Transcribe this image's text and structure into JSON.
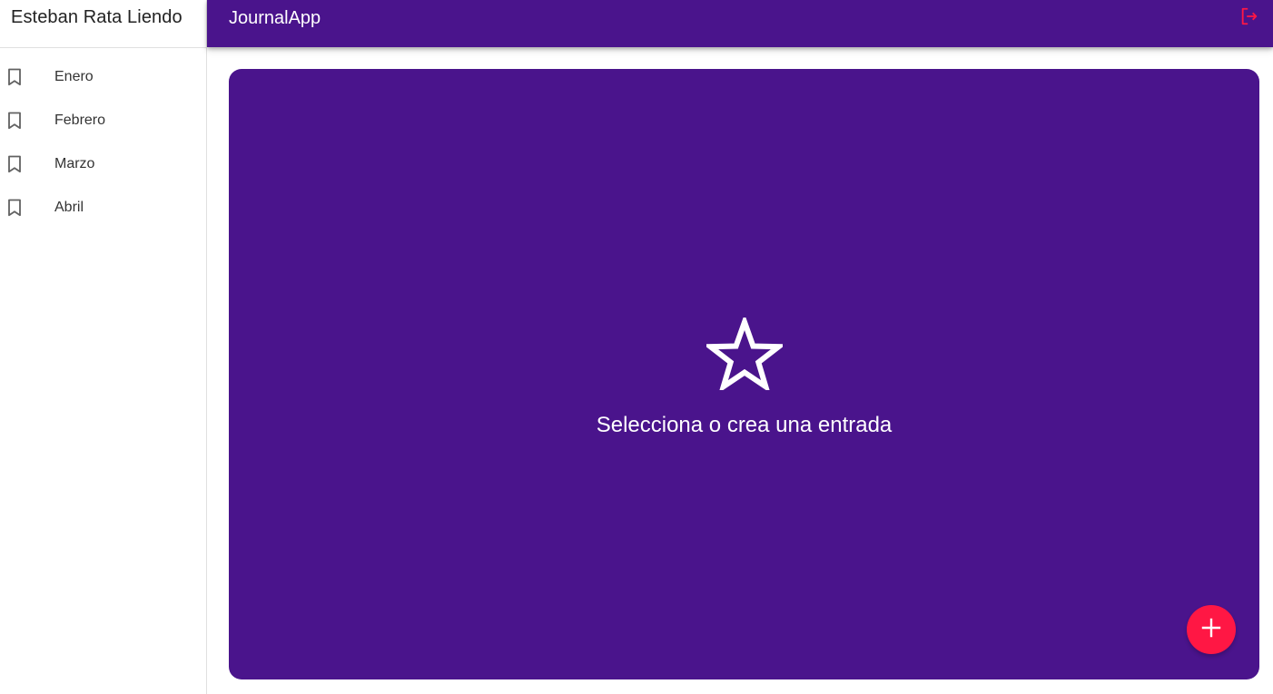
{
  "sidebar": {
    "user_name": "Esteban Rata Liendo",
    "items": [
      {
        "label": "Enero",
        "icon": "bookmark-icon"
      },
      {
        "label": "Febrero",
        "icon": "bookmark-icon"
      },
      {
        "label": "Marzo",
        "icon": "bookmark-icon"
      },
      {
        "label": "Abril",
        "icon": "bookmark-icon"
      }
    ]
  },
  "topbar": {
    "title": "JournalApp",
    "logout_icon": "logout-icon"
  },
  "main": {
    "empty_icon": "star-outline-icon",
    "empty_message": "Selecciona o crea una entrada",
    "fab_icon": "add-icon"
  },
  "colors": {
    "primary": "#4a148c",
    "accent": "#ff1744",
    "text_on_primary": "#ffffff"
  }
}
